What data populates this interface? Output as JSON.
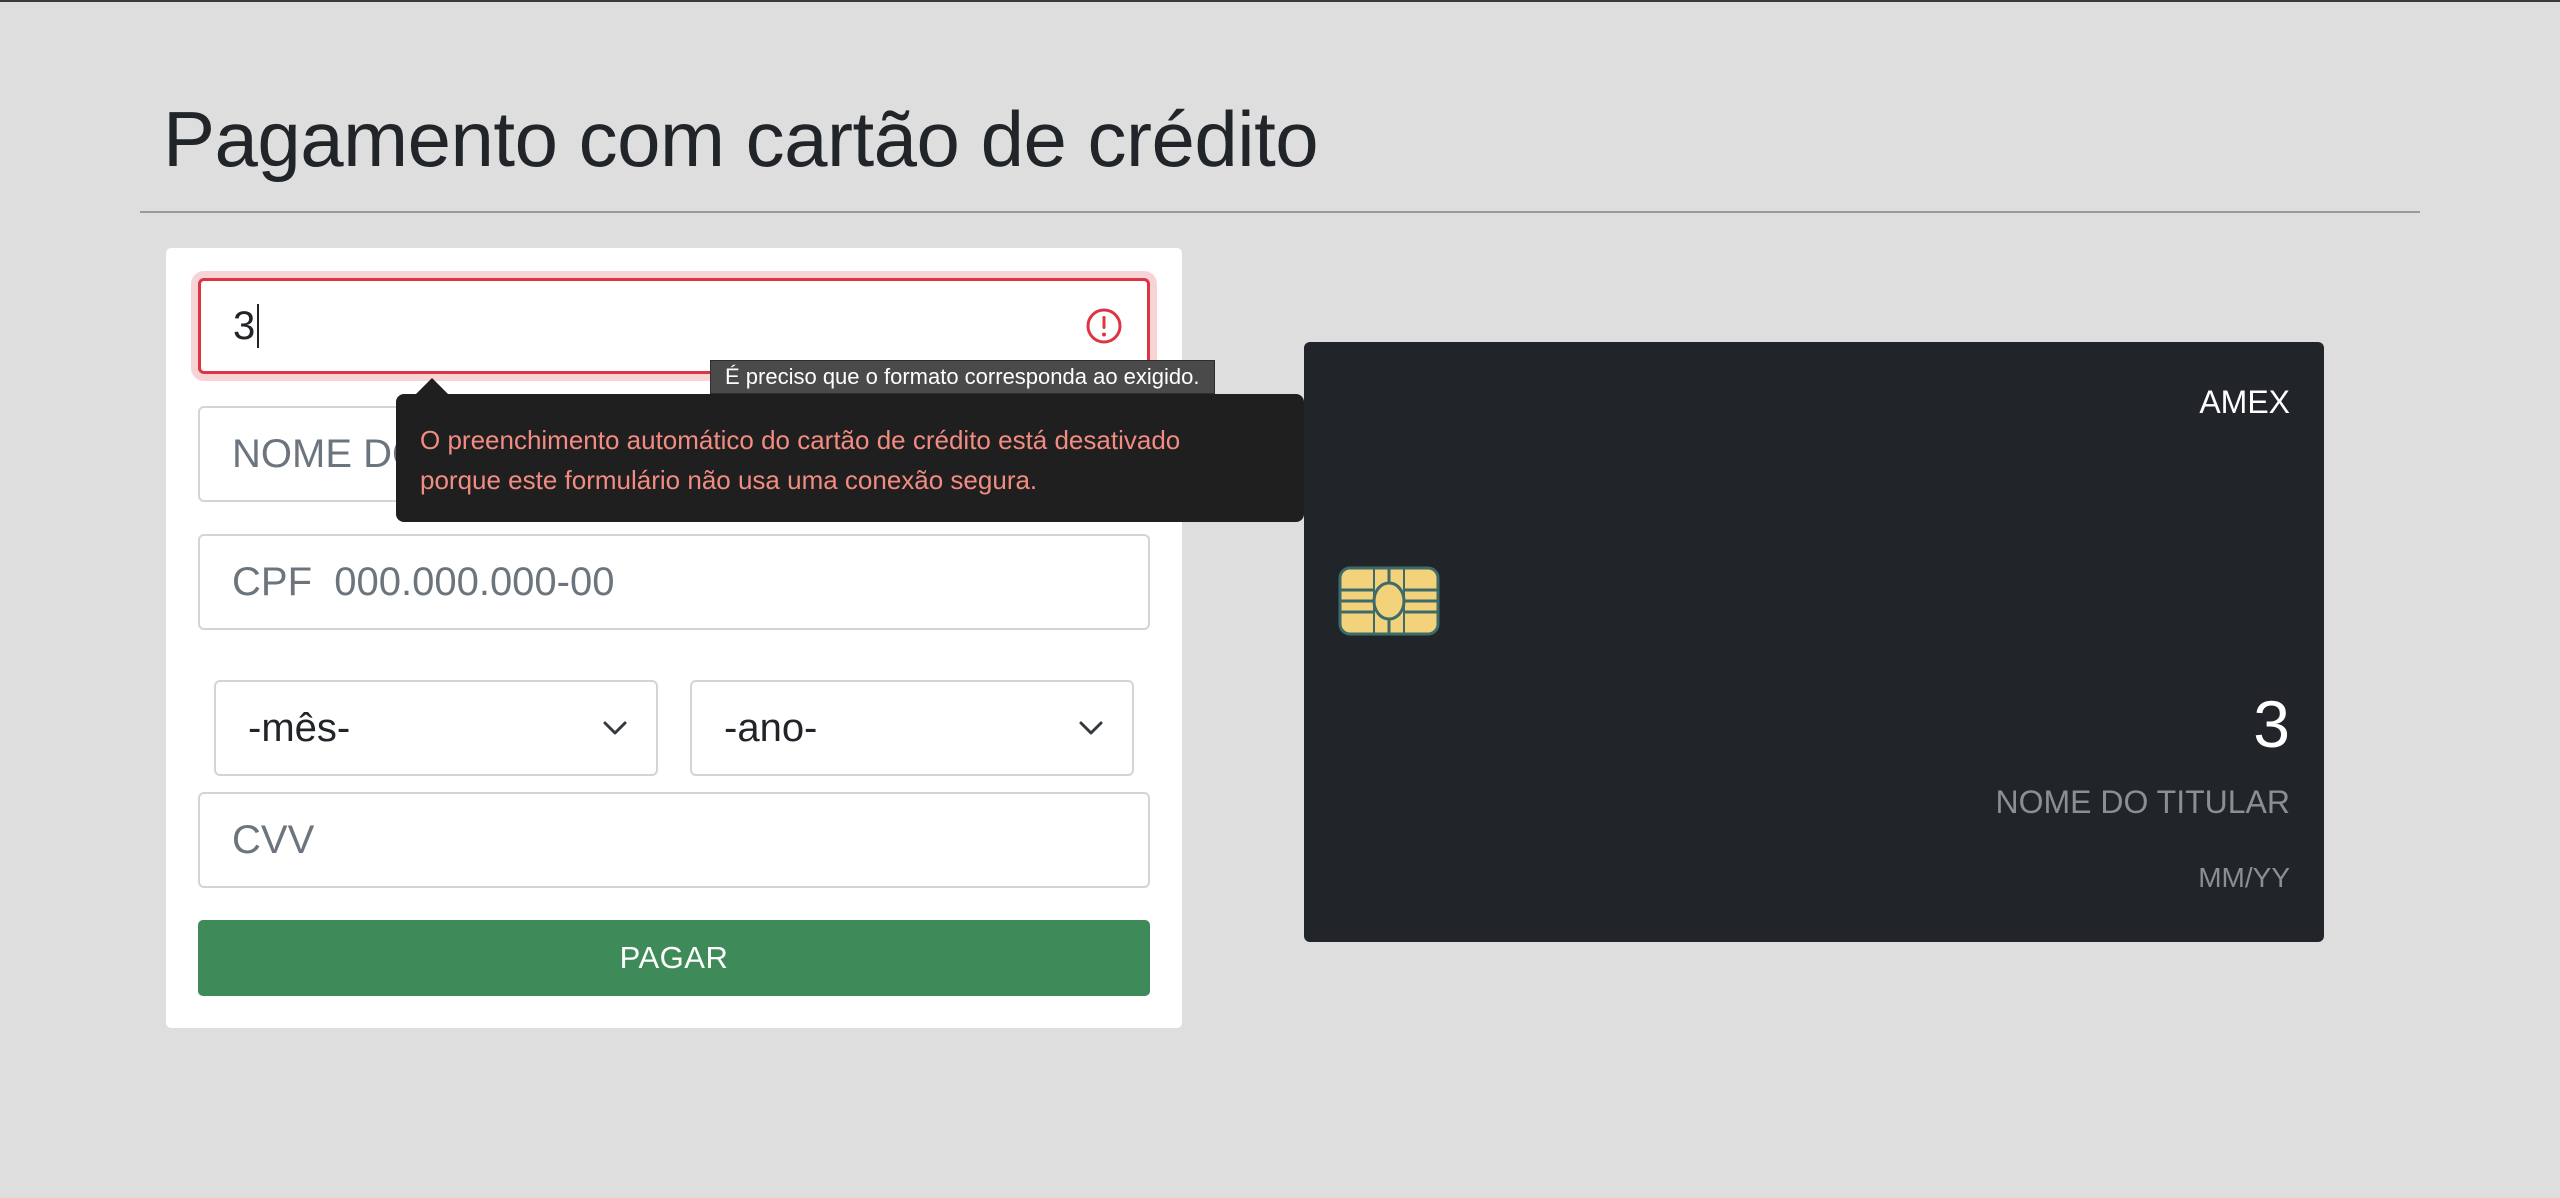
{
  "page": {
    "title": "Pagamento com cartão de crédito"
  },
  "form": {
    "card_number": {
      "value": "3",
      "state": "invalid"
    },
    "holder_name": {
      "placeholder_visible": "NOME DO"
    },
    "cpf": {
      "label": "CPF",
      "placeholder": "000.000.000-00"
    },
    "month_select": {
      "selected": "-mês-"
    },
    "year_select": {
      "selected": "-ano-"
    },
    "cvv": {
      "placeholder": "CVV"
    },
    "pay_button_label": "PAGAR"
  },
  "tooltips": {
    "validation_message": "É preciso que o formato corresponda ao exigido.",
    "autofill_line1": "O preenchimento automático do cartão de crédito está desativado",
    "autofill_line2": "porque este formulário não usa uma conexão segura."
  },
  "card_preview": {
    "brand": "AMEX",
    "number": "3",
    "holder": "NOME DO TITULAR",
    "expiry": "MM/YY"
  },
  "icons": {
    "error": "error-circle-icon",
    "chevron": "chevron-down-icon",
    "chip": "card-chip-icon"
  },
  "colors": {
    "background": "#dedede",
    "panel": "#ffffff",
    "error": "#dc3545",
    "pay_button": "#3e8a59",
    "card": "#212529",
    "chip": "#f2d27a",
    "autofill_text": "#f28b82"
  }
}
